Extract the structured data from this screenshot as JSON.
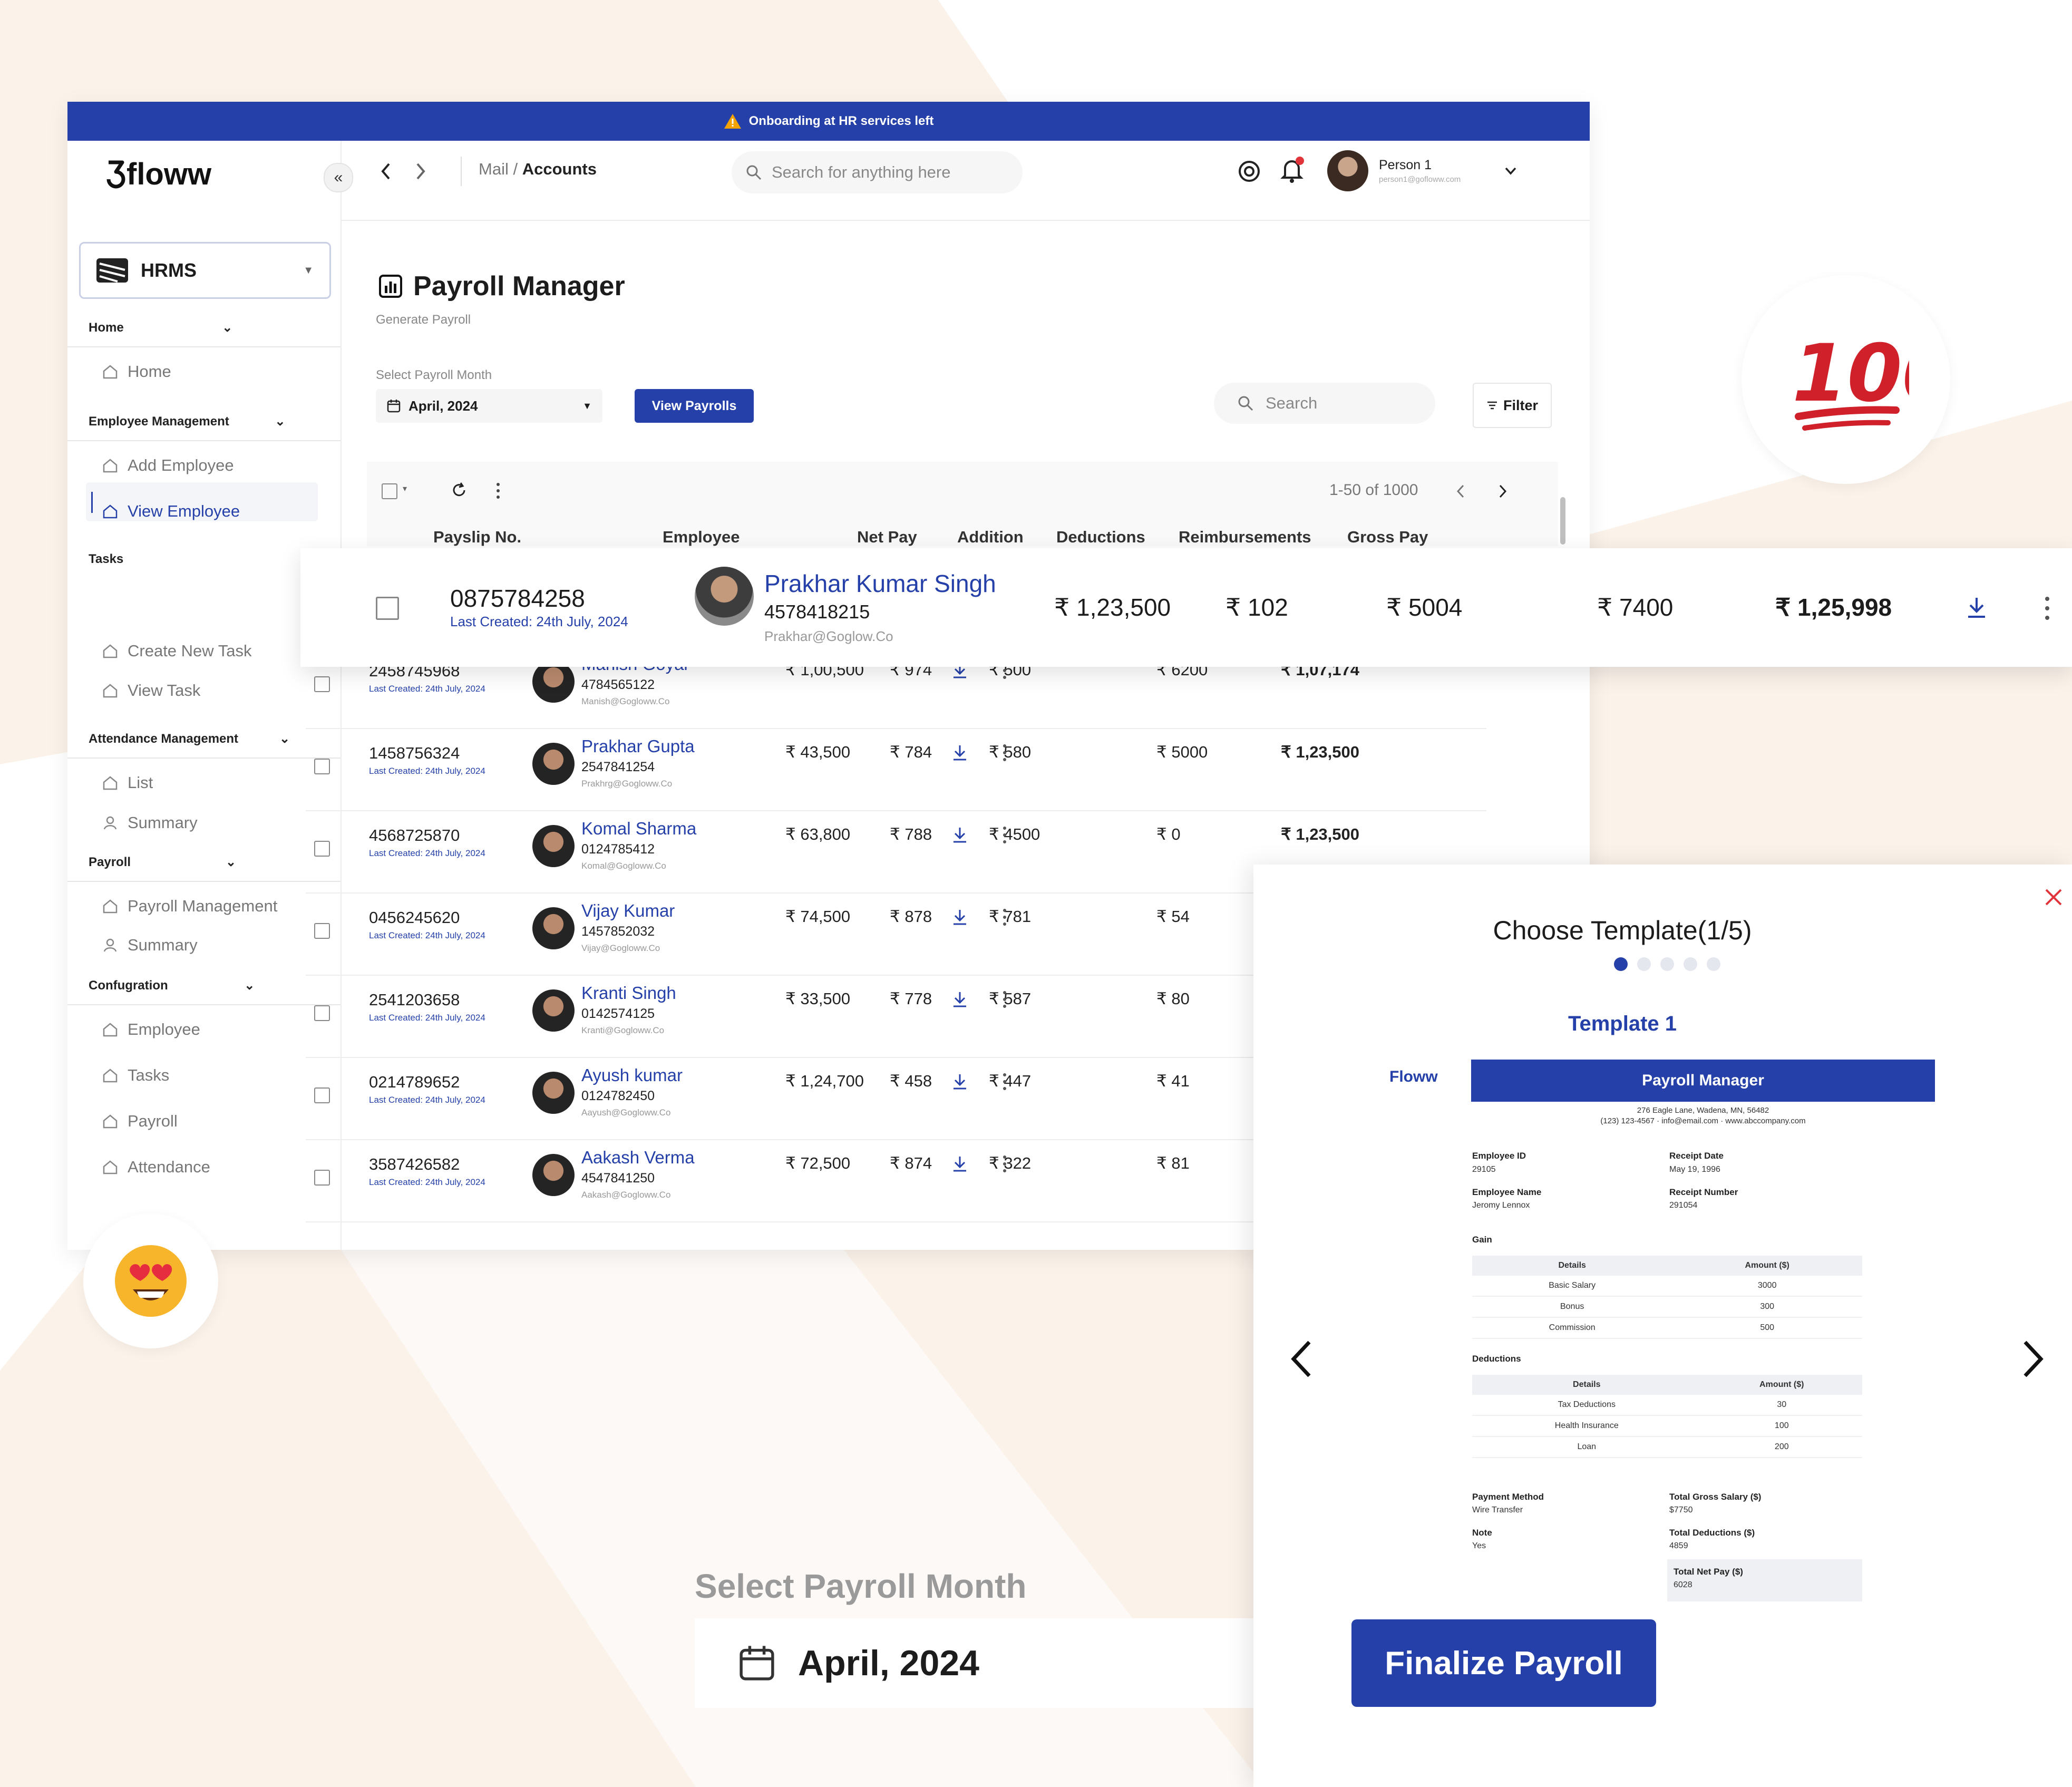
{
  "banner": {
    "text": "Onboarding at HR services left"
  },
  "app": {
    "logo": "floww"
  },
  "header": {
    "breadcrumb_parent": "Mail",
    "breadcrumb_sep": "/",
    "breadcrumb_current": "Accounts",
    "search_placeholder": "Search for anything here",
    "user_name": "Person 1",
    "user_email": "person1@gofloww.com"
  },
  "sidebar": {
    "workspace": "HRMS",
    "sections": {
      "home": "Home",
      "employee_management": "Employee Management",
      "tasks": "Tasks",
      "attendance": "Attendance Management",
      "payroll": "Payroll",
      "configuration": "Confugration"
    },
    "items": {
      "home": "Home",
      "add_employee": "Add Employee",
      "view_employee": "View Employee",
      "create_task": "Create New Task",
      "view_task": "View Task",
      "list": "List",
      "summary": "Summary",
      "payroll_management": "Payroll Management",
      "payroll_summary": "Summary",
      "cfg_employee": "Employee",
      "cfg_tasks": "Tasks",
      "cfg_payroll": "Payroll",
      "cfg_attendance": "Attendance"
    }
  },
  "page": {
    "title": "Payroll Manager",
    "subtitle": "Generate Payroll",
    "month_label": "Select Payroll Month",
    "month_value": "April, 2024",
    "view_button": "View Payrolls",
    "search_placeholder": "Search",
    "filter_label": "Filter",
    "pagination": "1-50 of 1000"
  },
  "table": {
    "columns": [
      "Payslip No.",
      "Employee",
      "Net Pay",
      "Addition",
      "Deductions",
      "Reimbursements",
      "Gross Pay"
    ],
    "highlighted": {
      "payslip": "0875784258",
      "date": "Last Created: 24th July, 2024",
      "name": "Prakhar Kumar Singh",
      "id": "4578418215",
      "email": "Prakhar@Goglow.Co",
      "net": "₹ 1,23,500",
      "addition": "₹ 102",
      "deductions": "₹ 5004",
      "reimb": "₹ 7400",
      "gross": "₹ 1,25,998"
    },
    "rows": [
      {
        "payslip": "2458745968",
        "date": "Last Created: 24th July, 2024",
        "name": "Manish Goyal",
        "id": "4784565122",
        "email": "Manish@Gogloww.Co",
        "net": "₹ 1,00,500",
        "addition": "₹ 974",
        "deductions": "₹ 500",
        "reimb": "₹ 6200",
        "gross": "₹ 1,07,174"
      },
      {
        "payslip": "1458756324",
        "date": "Last Created: 24th July, 2024",
        "name": "Prakhar Gupta",
        "id": "2547841254",
        "email": "Prakhrg@Gogloww.Co",
        "net": "₹ 43,500",
        "addition": "₹ 784",
        "deductions": "₹ 580",
        "reimb": "₹ 5000",
        "gross": "₹ 1,23,500"
      },
      {
        "payslip": "4568725870",
        "date": "Last Created: 24th July, 2024",
        "name": "Komal Sharma",
        "id": "0124785412",
        "email": "Komal@Gogloww.Co",
        "net": "₹ 63,800",
        "addition": "₹ 788",
        "deductions": "₹ 4500",
        "reimb": "₹ 0",
        "gross": "₹ 1,23,500"
      },
      {
        "payslip": "0456245620",
        "date": "Last Created: 24th July, 2024",
        "name": "Vijay Kumar",
        "id": "1457852032",
        "email": "Vijay@Gogloww.Co",
        "net": "₹ 74,500",
        "addition": "₹ 878",
        "deductions": "₹ 781",
        "reimb": "₹ 54",
        "gross": ""
      },
      {
        "payslip": "2541203658",
        "date": "Last Created: 24th July, 2024",
        "name": "Kranti Singh",
        "id": "0142574125",
        "email": "Kranti@Gogloww.Co",
        "net": "₹ 33,500",
        "addition": "₹ 778",
        "deductions": "₹ 587",
        "reimb": "₹ 80",
        "gross": ""
      },
      {
        "payslip": "0214789652",
        "date": "Last Created: 24th July, 2024",
        "name": "Ayush kumar",
        "id": "0124782450",
        "email": "Aayush@Gogloww.Co",
        "net": "₹ 1,24,700",
        "addition": "₹ 458",
        "deductions": "₹ 447",
        "reimb": "₹ 41",
        "gross": ""
      },
      {
        "payslip": "3587426582",
        "date": "Last Created: 24th July, 2024",
        "name": "Aakash Verma",
        "id": "4547841250",
        "email": "Aakash@Gogloww.Co",
        "net": "₹ 72,500",
        "addition": "₹ 874",
        "deductions": "₹ 322",
        "reimb": "₹ 81",
        "gross": ""
      }
    ]
  },
  "modal": {
    "title": "Choose Template(1/5)",
    "template_name": "Template 1",
    "tpl_logo": "Floww",
    "tpl_header": "Payroll Manager",
    "tpl_address1": "276 Eagle Lane, Wadena, MN, 56482",
    "tpl_address2": "(123) 123-4567 · info@email.com · www.abccompany.com",
    "emp_id_label": "Employee ID",
    "emp_id": "29105",
    "receipt_date_label": "Receipt Date",
    "receipt_date": "May 19, 1996",
    "emp_name_label": "Employee Name",
    "emp_name": "Jeromy Lennox",
    "receipt_no_label": "Receipt Number",
    "receipt_no": "291054",
    "gain_label": "Gain",
    "deductions_label": "Deductions",
    "col_details": "Details",
    "col_amount": "Amount ($)",
    "gain_rows": [
      [
        "Basic Salary",
        "3000"
      ],
      [
        "Bonus",
        "300"
      ],
      [
        "Commission",
        "500"
      ]
    ],
    "ded_rows": [
      [
        "Tax Deductions",
        "30"
      ],
      [
        "Health Insurance",
        "100"
      ],
      [
        "Loan",
        "200"
      ]
    ],
    "payment_method_label": "Payment Method",
    "payment_method": "Wire Transfer",
    "gross_label": "Total Gross Salary ($)",
    "gross": "$7750",
    "note_label": "Note",
    "note": "Yes",
    "total_ded_label": "Total Deductions ($)",
    "total_ded": "4859",
    "net_label": "Total Net Pay ($)",
    "net": "6028"
  },
  "bottom": {
    "month_label": "Select Payroll Month",
    "month_value": "April, 2024",
    "finalize": "Finalize Payroll"
  },
  "colors": {
    "primary": "#2540a8",
    "background": "#fbf2ea",
    "close": "#e0343a"
  }
}
